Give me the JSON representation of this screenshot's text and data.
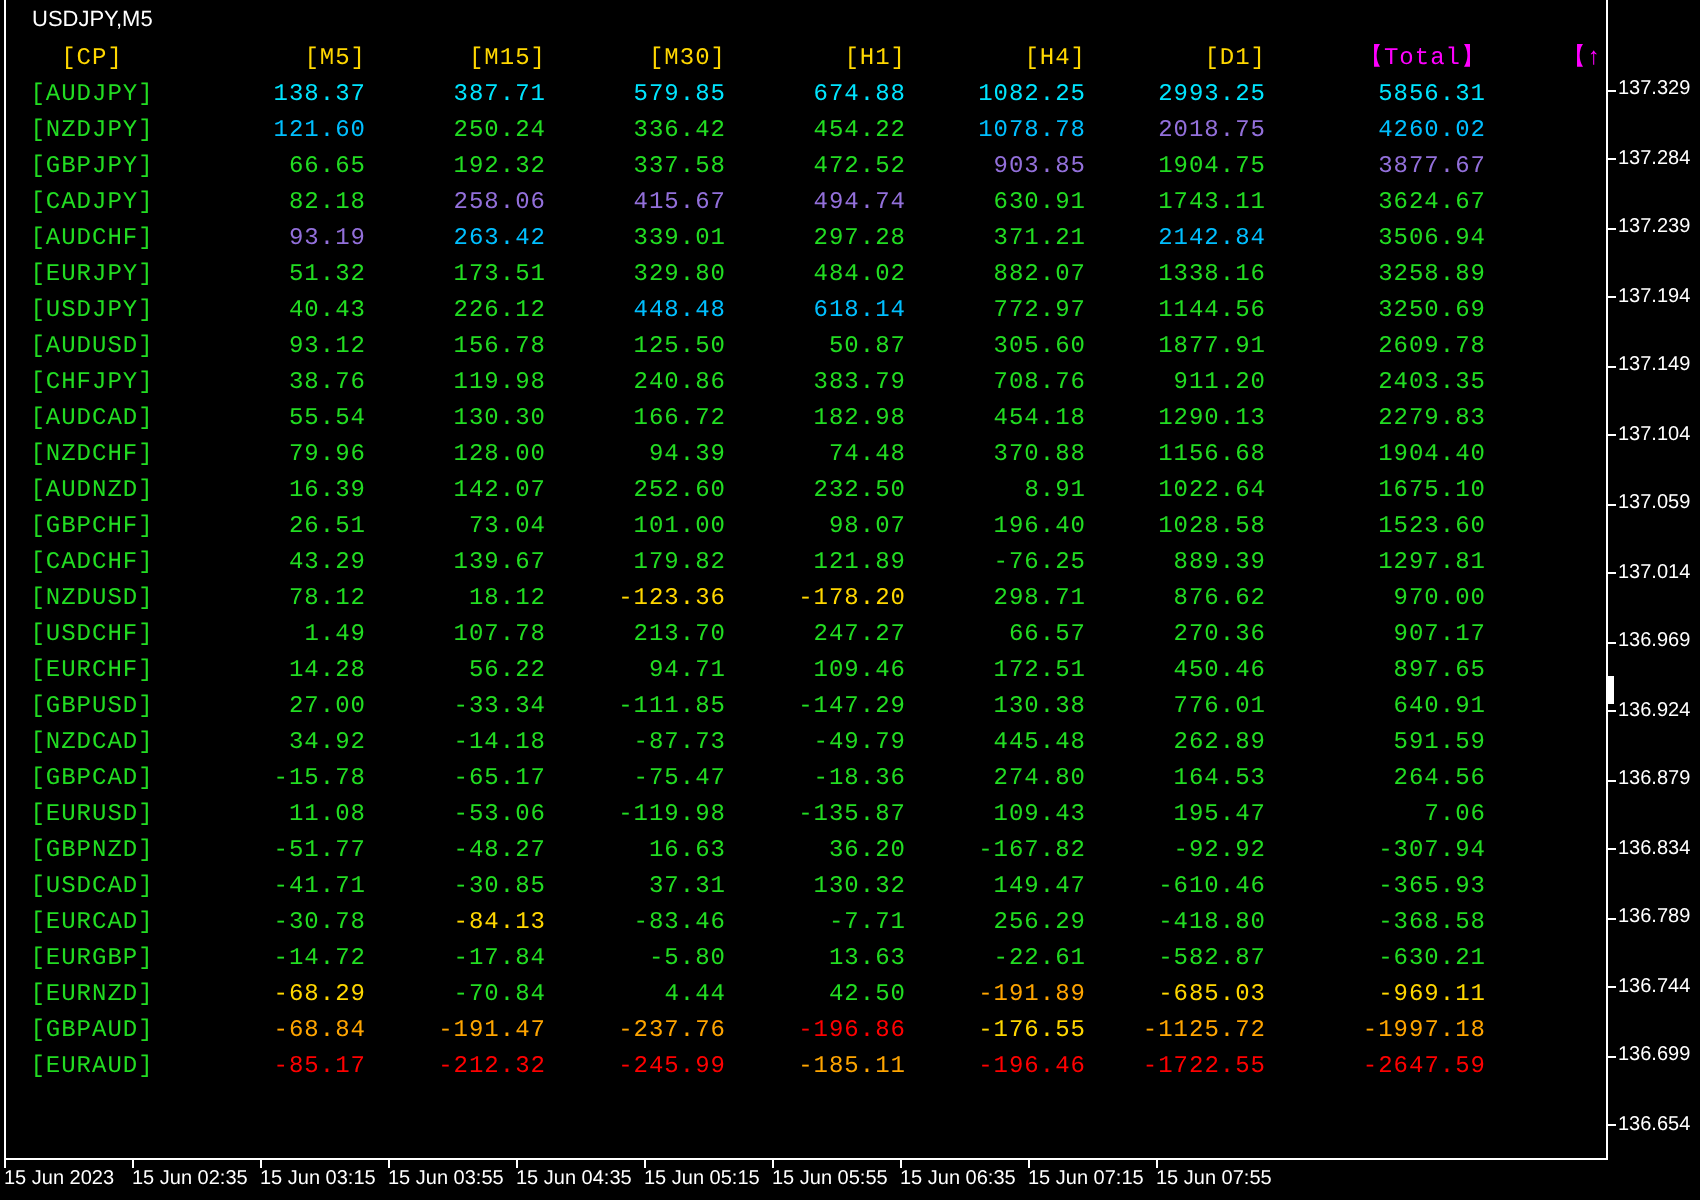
{
  "chart_title": "USDJPY,M5",
  "columns": [
    {
      "label": "[CP]",
      "color": "#ffd700"
    },
    {
      "label": "[M5]",
      "color": "#ffd700"
    },
    {
      "label": "[M15]",
      "color": "#ffd700"
    },
    {
      "label": "[M30]",
      "color": "#ffd700"
    },
    {
      "label": "[H1]",
      "color": "#ffd700"
    },
    {
      "label": "[H4]",
      "color": "#ffd700"
    },
    {
      "label": "[D1]",
      "color": "#ffd700"
    },
    {
      "label": "【Total】",
      "color": "#ff00ff"
    },
    {
      "label": "【↑",
      "color": "#ff00ff"
    }
  ],
  "rows": [
    {
      "pair": "[AUDJPY]",
      "values": [
        {
          "text": "138.37",
          "color": "#00e5ff"
        },
        {
          "text": "387.71",
          "color": "#00e5ff"
        },
        {
          "text": "579.85",
          "color": "#00e5ff"
        },
        {
          "text": "674.88",
          "color": "#00e5ff"
        },
        {
          "text": "1082.25",
          "color": "#00e5ff"
        },
        {
          "text": "2993.25",
          "color": "#00e5ff"
        },
        {
          "text": "5856.31",
          "color": "#00e5ff"
        }
      ]
    },
    {
      "pair": "[NZDJPY]",
      "values": [
        {
          "text": "121.60",
          "color": "#00bfff"
        },
        {
          "text": "250.24",
          "color": "#22dd22"
        },
        {
          "text": "336.42",
          "color": "#22dd22"
        },
        {
          "text": "454.22",
          "color": "#22dd22"
        },
        {
          "text": "1078.78",
          "color": "#00bfff"
        },
        {
          "text": "2018.75",
          "color": "#9370db"
        },
        {
          "text": "4260.02",
          "color": "#00bfff"
        }
      ]
    },
    {
      "pair": "[GBPJPY]",
      "values": [
        {
          "text": "66.65",
          "color": "#22dd22"
        },
        {
          "text": "192.32",
          "color": "#22dd22"
        },
        {
          "text": "337.58",
          "color": "#22dd22"
        },
        {
          "text": "472.52",
          "color": "#22dd22"
        },
        {
          "text": "903.85",
          "color": "#9370db"
        },
        {
          "text": "1904.75",
          "color": "#22dd22"
        },
        {
          "text": "3877.67",
          "color": "#9370db"
        }
      ]
    },
    {
      "pair": "[CADJPY]",
      "values": [
        {
          "text": "82.18",
          "color": "#22dd22"
        },
        {
          "text": "258.06",
          "color": "#9370db"
        },
        {
          "text": "415.67",
          "color": "#9370db"
        },
        {
          "text": "494.74",
          "color": "#9370db"
        },
        {
          "text": "630.91",
          "color": "#22dd22"
        },
        {
          "text": "1743.11",
          "color": "#22dd22"
        },
        {
          "text": "3624.67",
          "color": "#22dd22"
        }
      ]
    },
    {
      "pair": "[AUDCHF]",
      "values": [
        {
          "text": "93.19",
          "color": "#9370db"
        },
        {
          "text": "263.42",
          "color": "#00bfff"
        },
        {
          "text": "339.01",
          "color": "#22dd22"
        },
        {
          "text": "297.28",
          "color": "#22dd22"
        },
        {
          "text": "371.21",
          "color": "#22dd22"
        },
        {
          "text": "2142.84",
          "color": "#00bfff"
        },
        {
          "text": "3506.94",
          "color": "#22dd22"
        }
      ]
    },
    {
      "pair": "[EURJPY]",
      "values": [
        {
          "text": "51.32",
          "color": "#22dd22"
        },
        {
          "text": "173.51",
          "color": "#22dd22"
        },
        {
          "text": "329.80",
          "color": "#22dd22"
        },
        {
          "text": "484.02",
          "color": "#22dd22"
        },
        {
          "text": "882.07",
          "color": "#22dd22"
        },
        {
          "text": "1338.16",
          "color": "#22dd22"
        },
        {
          "text": "3258.89",
          "color": "#22dd22"
        }
      ]
    },
    {
      "pair": "[USDJPY]",
      "values": [
        {
          "text": "40.43",
          "color": "#22dd22"
        },
        {
          "text": "226.12",
          "color": "#22dd22"
        },
        {
          "text": "448.48",
          "color": "#00bfff"
        },
        {
          "text": "618.14",
          "color": "#00bfff"
        },
        {
          "text": "772.97",
          "color": "#22dd22"
        },
        {
          "text": "1144.56",
          "color": "#22dd22"
        },
        {
          "text": "3250.69",
          "color": "#22dd22"
        }
      ]
    },
    {
      "pair": "[AUDUSD]",
      "values": [
        {
          "text": "93.12",
          "color": "#22dd22"
        },
        {
          "text": "156.78",
          "color": "#22dd22"
        },
        {
          "text": "125.50",
          "color": "#22dd22"
        },
        {
          "text": "50.87",
          "color": "#22dd22"
        },
        {
          "text": "305.60",
          "color": "#22dd22"
        },
        {
          "text": "1877.91",
          "color": "#22dd22"
        },
        {
          "text": "2609.78",
          "color": "#22dd22"
        }
      ]
    },
    {
      "pair": "[CHFJPY]",
      "values": [
        {
          "text": "38.76",
          "color": "#22dd22"
        },
        {
          "text": "119.98",
          "color": "#22dd22"
        },
        {
          "text": "240.86",
          "color": "#22dd22"
        },
        {
          "text": "383.79",
          "color": "#22dd22"
        },
        {
          "text": "708.76",
          "color": "#22dd22"
        },
        {
          "text": "911.20",
          "color": "#22dd22"
        },
        {
          "text": "2403.35",
          "color": "#22dd22"
        }
      ]
    },
    {
      "pair": "[AUDCAD]",
      "values": [
        {
          "text": "55.54",
          "color": "#22dd22"
        },
        {
          "text": "130.30",
          "color": "#22dd22"
        },
        {
          "text": "166.72",
          "color": "#22dd22"
        },
        {
          "text": "182.98",
          "color": "#22dd22"
        },
        {
          "text": "454.18",
          "color": "#22dd22"
        },
        {
          "text": "1290.13",
          "color": "#22dd22"
        },
        {
          "text": "2279.83",
          "color": "#22dd22"
        }
      ]
    },
    {
      "pair": "[NZDCHF]",
      "values": [
        {
          "text": "79.96",
          "color": "#22dd22"
        },
        {
          "text": "128.00",
          "color": "#22dd22"
        },
        {
          "text": "94.39",
          "color": "#22dd22"
        },
        {
          "text": "74.48",
          "color": "#22dd22"
        },
        {
          "text": "370.88",
          "color": "#22dd22"
        },
        {
          "text": "1156.68",
          "color": "#22dd22"
        },
        {
          "text": "1904.40",
          "color": "#22dd22"
        }
      ]
    },
    {
      "pair": "[AUDNZD]",
      "values": [
        {
          "text": "16.39",
          "color": "#22dd22"
        },
        {
          "text": "142.07",
          "color": "#22dd22"
        },
        {
          "text": "252.60",
          "color": "#22dd22"
        },
        {
          "text": "232.50",
          "color": "#22dd22"
        },
        {
          "text": "8.91",
          "color": "#22dd22"
        },
        {
          "text": "1022.64",
          "color": "#22dd22"
        },
        {
          "text": "1675.10",
          "color": "#22dd22"
        }
      ]
    },
    {
      "pair": "[GBPCHF]",
      "values": [
        {
          "text": "26.51",
          "color": "#22dd22"
        },
        {
          "text": "73.04",
          "color": "#22dd22"
        },
        {
          "text": "101.00",
          "color": "#22dd22"
        },
        {
          "text": "98.07",
          "color": "#22dd22"
        },
        {
          "text": "196.40",
          "color": "#22dd22"
        },
        {
          "text": "1028.58",
          "color": "#22dd22"
        },
        {
          "text": "1523.60",
          "color": "#22dd22"
        }
      ]
    },
    {
      "pair": "[CADCHF]",
      "values": [
        {
          "text": "43.29",
          "color": "#22dd22"
        },
        {
          "text": "139.67",
          "color": "#22dd22"
        },
        {
          "text": "179.82",
          "color": "#22dd22"
        },
        {
          "text": "121.89",
          "color": "#22dd22"
        },
        {
          "text": "-76.25",
          "color": "#22dd22"
        },
        {
          "text": "889.39",
          "color": "#22dd22"
        },
        {
          "text": "1297.81",
          "color": "#22dd22"
        }
      ]
    },
    {
      "pair": "[NZDUSD]",
      "values": [
        {
          "text": "78.12",
          "color": "#22dd22"
        },
        {
          "text": "18.12",
          "color": "#22dd22"
        },
        {
          "text": "-123.36",
          "color": "#ffd700"
        },
        {
          "text": "-178.20",
          "color": "#ffd700"
        },
        {
          "text": "298.71",
          "color": "#22dd22"
        },
        {
          "text": "876.62",
          "color": "#22dd22"
        },
        {
          "text": "970.00",
          "color": "#22dd22"
        }
      ]
    },
    {
      "pair": "[USDCHF]",
      "values": [
        {
          "text": "1.49",
          "color": "#22dd22"
        },
        {
          "text": "107.78",
          "color": "#22dd22"
        },
        {
          "text": "213.70",
          "color": "#22dd22"
        },
        {
          "text": "247.27",
          "color": "#22dd22"
        },
        {
          "text": "66.57",
          "color": "#22dd22"
        },
        {
          "text": "270.36",
          "color": "#22dd22"
        },
        {
          "text": "907.17",
          "color": "#22dd22"
        }
      ]
    },
    {
      "pair": "[EURCHF]",
      "values": [
        {
          "text": "14.28",
          "color": "#22dd22"
        },
        {
          "text": "56.22",
          "color": "#22dd22"
        },
        {
          "text": "94.71",
          "color": "#22dd22"
        },
        {
          "text": "109.46",
          "color": "#22dd22"
        },
        {
          "text": "172.51",
          "color": "#22dd22"
        },
        {
          "text": "450.46",
          "color": "#22dd22"
        },
        {
          "text": "897.65",
          "color": "#22dd22"
        }
      ]
    },
    {
      "pair": "[GBPUSD]",
      "values": [
        {
          "text": "27.00",
          "color": "#22dd22"
        },
        {
          "text": "-33.34",
          "color": "#22dd22"
        },
        {
          "text": "-111.85",
          "color": "#22dd22"
        },
        {
          "text": "-147.29",
          "color": "#22dd22"
        },
        {
          "text": "130.38",
          "color": "#22dd22"
        },
        {
          "text": "776.01",
          "color": "#22dd22"
        },
        {
          "text": "640.91",
          "color": "#22dd22"
        }
      ]
    },
    {
      "pair": "[NZDCAD]",
      "values": [
        {
          "text": "34.92",
          "color": "#22dd22"
        },
        {
          "text": "-14.18",
          "color": "#22dd22"
        },
        {
          "text": "-87.73",
          "color": "#22dd22"
        },
        {
          "text": "-49.79",
          "color": "#22dd22"
        },
        {
          "text": "445.48",
          "color": "#22dd22"
        },
        {
          "text": "262.89",
          "color": "#22dd22"
        },
        {
          "text": "591.59",
          "color": "#22dd22"
        }
      ]
    },
    {
      "pair": "[GBPCAD]",
      "values": [
        {
          "text": "-15.78",
          "color": "#22dd22"
        },
        {
          "text": "-65.17",
          "color": "#22dd22"
        },
        {
          "text": "-75.47",
          "color": "#22dd22"
        },
        {
          "text": "-18.36",
          "color": "#22dd22"
        },
        {
          "text": "274.80",
          "color": "#22dd22"
        },
        {
          "text": "164.53",
          "color": "#22dd22"
        },
        {
          "text": "264.56",
          "color": "#22dd22"
        }
      ]
    },
    {
      "pair": "[EURUSD]",
      "values": [
        {
          "text": "11.08",
          "color": "#22dd22"
        },
        {
          "text": "-53.06",
          "color": "#22dd22"
        },
        {
          "text": "-119.98",
          "color": "#22dd22"
        },
        {
          "text": "-135.87",
          "color": "#22dd22"
        },
        {
          "text": "109.43",
          "color": "#22dd22"
        },
        {
          "text": "195.47",
          "color": "#22dd22"
        },
        {
          "text": "7.06",
          "color": "#22dd22"
        }
      ]
    },
    {
      "pair": "[GBPNZD]",
      "values": [
        {
          "text": "-51.77",
          "color": "#22dd22"
        },
        {
          "text": "-48.27",
          "color": "#22dd22"
        },
        {
          "text": "16.63",
          "color": "#22dd22"
        },
        {
          "text": "36.20",
          "color": "#22dd22"
        },
        {
          "text": "-167.82",
          "color": "#22dd22"
        },
        {
          "text": "-92.92",
          "color": "#22dd22"
        },
        {
          "text": "-307.94",
          "color": "#22dd22"
        }
      ]
    },
    {
      "pair": "[USDCAD]",
      "values": [
        {
          "text": "-41.71",
          "color": "#22dd22"
        },
        {
          "text": "-30.85",
          "color": "#22dd22"
        },
        {
          "text": "37.31",
          "color": "#22dd22"
        },
        {
          "text": "130.32",
          "color": "#22dd22"
        },
        {
          "text": "149.47",
          "color": "#22dd22"
        },
        {
          "text": "-610.46",
          "color": "#22dd22"
        },
        {
          "text": "-365.93",
          "color": "#22dd22"
        }
      ]
    },
    {
      "pair": "[EURCAD]",
      "values": [
        {
          "text": "-30.78",
          "color": "#22dd22"
        },
        {
          "text": "-84.13",
          "color": "#ffd700"
        },
        {
          "text": "-83.46",
          "color": "#22dd22"
        },
        {
          "text": "-7.71",
          "color": "#22dd22"
        },
        {
          "text": "256.29",
          "color": "#22dd22"
        },
        {
          "text": "-418.80",
          "color": "#22dd22"
        },
        {
          "text": "-368.58",
          "color": "#22dd22"
        }
      ]
    },
    {
      "pair": "[EURGBP]",
      "values": [
        {
          "text": "-14.72",
          "color": "#22dd22"
        },
        {
          "text": "-17.84",
          "color": "#22dd22"
        },
        {
          "text": "-5.80",
          "color": "#22dd22"
        },
        {
          "text": "13.63",
          "color": "#22dd22"
        },
        {
          "text": "-22.61",
          "color": "#22dd22"
        },
        {
          "text": "-582.87",
          "color": "#22dd22"
        },
        {
          "text": "-630.21",
          "color": "#22dd22"
        }
      ]
    },
    {
      "pair": "[EURNZD]",
      "values": [
        {
          "text": "-68.29",
          "color": "#ffd700"
        },
        {
          "text": "-70.84",
          "color": "#22dd22"
        },
        {
          "text": "4.44",
          "color": "#22dd22"
        },
        {
          "text": "42.50",
          "color": "#22dd22"
        },
        {
          "text": "-191.89",
          "color": "#ffa500"
        },
        {
          "text": "-685.03",
          "color": "#ffd700"
        },
        {
          "text": "-969.11",
          "color": "#ffd700"
        }
      ]
    },
    {
      "pair": "[GBPAUD]",
      "values": [
        {
          "text": "-68.84",
          "color": "#ffa500"
        },
        {
          "text": "-191.47",
          "color": "#ffa500"
        },
        {
          "text": "-237.76",
          "color": "#ffa500"
        },
        {
          "text": "-196.86",
          "color": "#ff0000"
        },
        {
          "text": "-176.55",
          "color": "#ffd700"
        },
        {
          "text": "-1125.72",
          "color": "#ffa500"
        },
        {
          "text": "-1997.18",
          "color": "#ffa500"
        }
      ]
    },
    {
      "pair": "[EURAUD]",
      "values": [
        {
          "text": "-85.17",
          "color": "#ff0000"
        },
        {
          "text": "-212.32",
          "color": "#ff0000"
        },
        {
          "text": "-245.99",
          "color": "#ff0000"
        },
        {
          "text": "-185.11",
          "color": "#ffa500"
        },
        {
          "text": "-196.46",
          "color": "#ff0000"
        },
        {
          "text": "-1722.55",
          "color": "#ff0000"
        },
        {
          "text": "-2647.59",
          "color": "#ff0000"
        }
      ]
    }
  ],
  "price_axis": [
    "137.329",
    "137.284",
    "137.239",
    "137.194",
    "137.149",
    "137.104",
    "137.059",
    "137.014",
    "136.969",
    "136.924",
    "136.879",
    "136.834",
    "136.789",
    "136.744",
    "136.699",
    "136.654"
  ],
  "time_axis": [
    "15 Jun 2023",
    "15 Jun 02:35",
    "15 Jun 03:15",
    "15 Jun 03:55",
    "15 Jun 04:35",
    "15 Jun 05:15",
    "15 Jun 05:55",
    "15 Jun 06:35",
    "15 Jun 07:15",
    "15 Jun 07:55"
  ]
}
